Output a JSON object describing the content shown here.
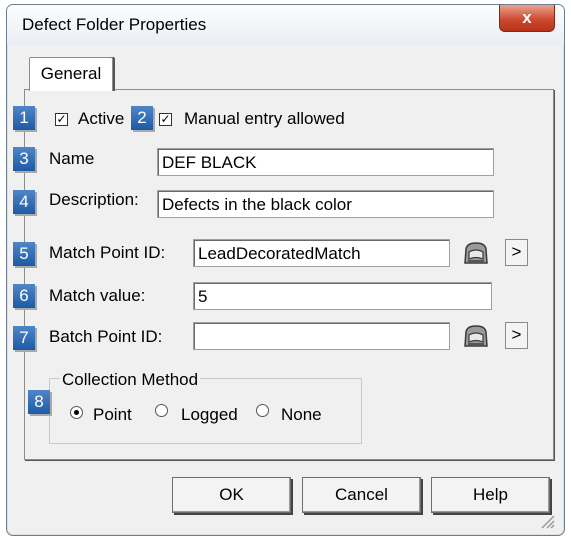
{
  "window": {
    "title": "Defect Folder Properties",
    "close_glyph": "x"
  },
  "tab": {
    "label": "General"
  },
  "badges": [
    "1",
    "2",
    "3",
    "4",
    "5",
    "6",
    "7",
    "8"
  ],
  "active": {
    "label": "Active",
    "checked": true
  },
  "manual_entry": {
    "label": "Manual entry allowed",
    "checked": true
  },
  "name": {
    "label": "Name",
    "value": "DEF BLACK"
  },
  "description": {
    "label": "Description:",
    "value": "Defects in the black color"
  },
  "match_point": {
    "label": "Match Point ID:",
    "value": "LeadDecoratedMatch",
    "browse_glyph": ">"
  },
  "match_value": {
    "label": "Match value:",
    "value": "5"
  },
  "batch_point": {
    "label": "Batch Point ID:",
    "value": "",
    "browse_glyph": ">"
  },
  "collection": {
    "title": "Collection  Method",
    "options": [
      "Point",
      "Logged",
      "None"
    ],
    "selected": "Point"
  },
  "buttons": {
    "ok": "OK",
    "cancel": "Cancel",
    "help": "Help"
  },
  "colors": {
    "badge": "#2a67b0",
    "close": "#cc4b31"
  }
}
